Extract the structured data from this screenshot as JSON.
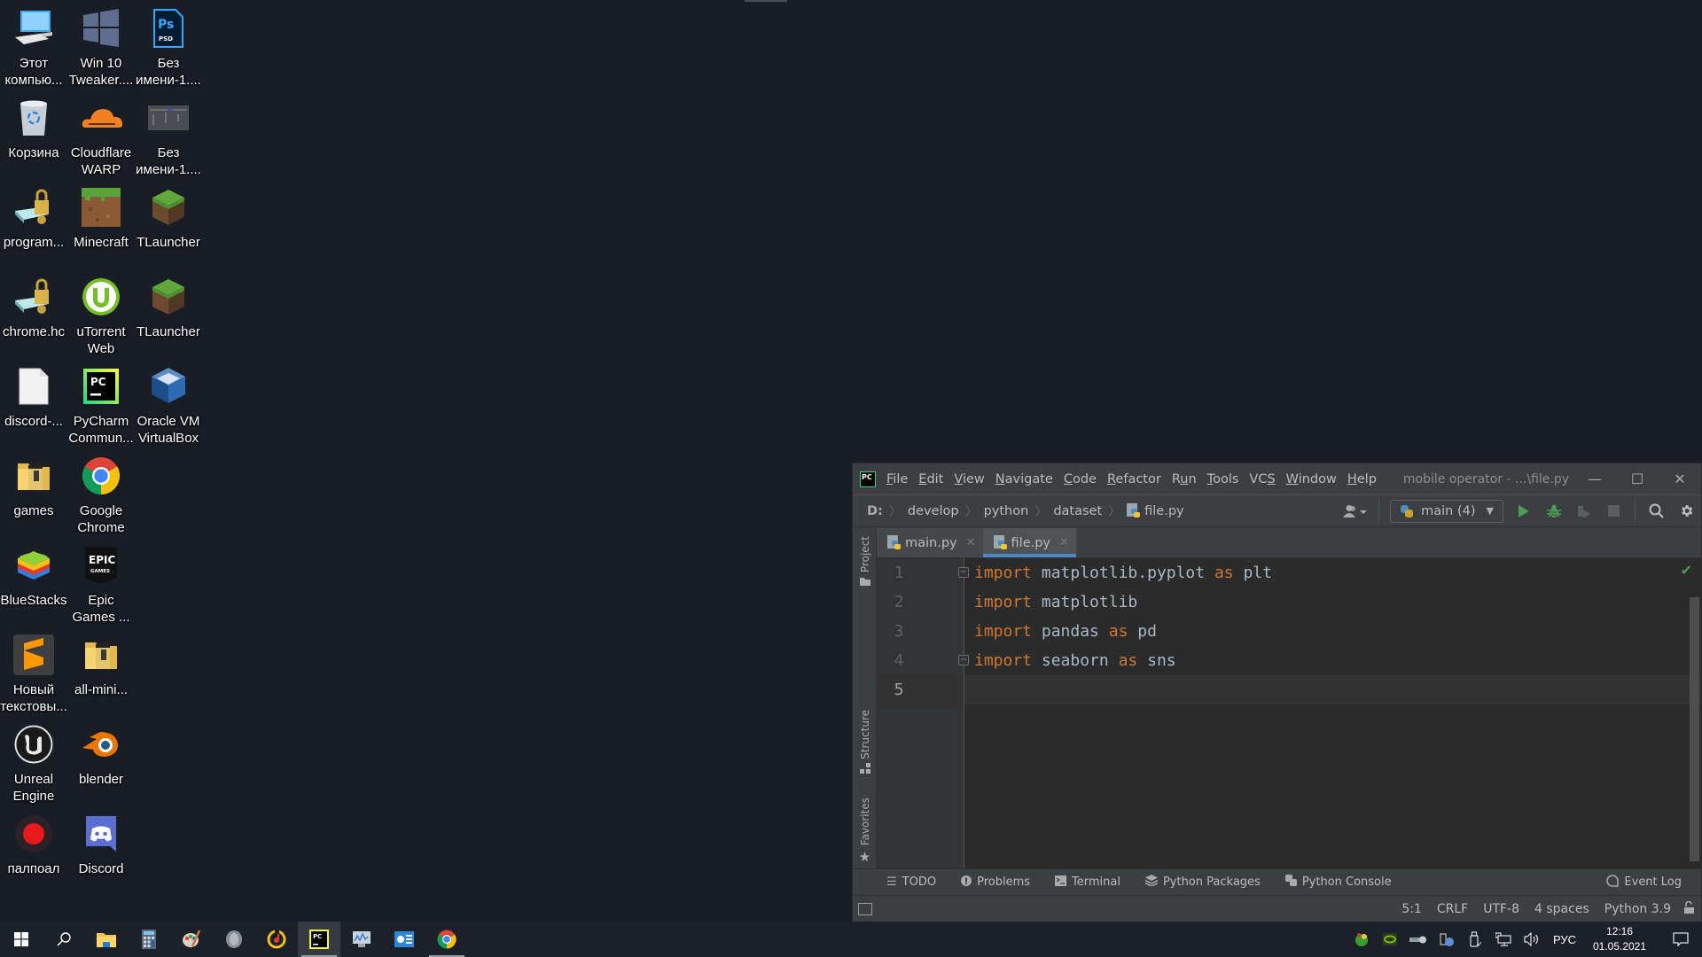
{
  "desktop": {
    "icons": [
      {
        "label": "Этот\nкомпью...",
        "icon": "this-pc-icon"
      },
      {
        "label": "Win 10\nTweaker....",
        "icon": "windows-logo-icon"
      },
      {
        "label": "Без\nимени-1....",
        "icon": "photoshop-psd-icon"
      },
      {
        "label": "Корзина",
        "icon": "recycle-bin-icon"
      },
      {
        "label": "Cloudflare\nWARP",
        "icon": "cloudflare-icon"
      },
      {
        "label": "Без\nимени-1....",
        "icon": "image-thumbnail-icon"
      },
      {
        "label": "program...",
        "icon": "locked-drive-icon"
      },
      {
        "label": "Minecraft",
        "icon": "minecraft-icon"
      },
      {
        "label": "TLauncher",
        "icon": "tlauncher-icon"
      },
      {
        "label": "chrome.hc",
        "icon": "locked-drive-icon"
      },
      {
        "label": "uTorrent\nWeb",
        "icon": "utorrent-icon"
      },
      {
        "label": "TLauncher",
        "icon": "tlauncher-icon"
      },
      {
        "label": "discord-...",
        "icon": "blank-file-icon"
      },
      {
        "label": "PyCharm\nCommun...",
        "icon": "pycharm-icon"
      },
      {
        "label": "Oracle VM\nVirtualBox",
        "icon": "virtualbox-icon"
      },
      {
        "label": "games",
        "icon": "folder-icon"
      },
      {
        "label": "Google\nChrome",
        "icon": "chrome-icon"
      },
      {
        "label": "BlueStacks",
        "icon": "bluestacks-icon"
      },
      {
        "label": "Epic\nGames ...",
        "icon": "epic-games-icon"
      },
      {
        "label": "Новый\nтекстовы...",
        "icon": "sublime-text-icon"
      },
      {
        "label": "all-mini...",
        "icon": "folder-icon"
      },
      {
        "label": "Unreal\nEngine",
        "icon": "unreal-engine-icon"
      },
      {
        "label": "blender",
        "icon": "blender-icon"
      },
      {
        "label": "палпоал",
        "icon": "record-icon"
      },
      {
        "label": "Discord",
        "icon": "discord-icon"
      }
    ]
  },
  "ide": {
    "logo": "PC",
    "menu": [
      {
        "label": "File",
        "mnemonic": "F"
      },
      {
        "label": "Edit",
        "mnemonic": "E"
      },
      {
        "label": "View",
        "mnemonic": "V"
      },
      {
        "label": "Navigate",
        "mnemonic": "N"
      },
      {
        "label": "Code",
        "mnemonic": "C"
      },
      {
        "label": "Refactor",
        "mnemonic": "R"
      },
      {
        "label": "Run",
        "mnemonic": "u"
      },
      {
        "label": "Tools",
        "mnemonic": "T"
      },
      {
        "label": "VCS",
        "mnemonic": "S"
      },
      {
        "label": "Window",
        "mnemonic": "W"
      },
      {
        "label": "Help",
        "mnemonic": "H"
      }
    ],
    "window_title": "mobile operator - ...\\file.py",
    "breadcrumbs": [
      "D:",
      "develop",
      "python",
      "dataset",
      "file.py"
    ],
    "run_config": "main (4)",
    "tabs": [
      {
        "label": "main.py",
        "active": false
      },
      {
        "label": "file.py",
        "active": true
      }
    ],
    "left_tool_windows": [
      "Project",
      "Structure",
      "Favorites"
    ],
    "code_lines": [
      [
        {
          "t": "import",
          "k": true
        },
        {
          "t": " matplotlib.pyplot ",
          "k": false
        },
        {
          "t": "as",
          "k": true
        },
        {
          "t": " plt",
          "k": false
        }
      ],
      [
        {
          "t": "import",
          "k": true
        },
        {
          "t": " matplotlib",
          "k": false
        }
      ],
      [
        {
          "t": "import",
          "k": true
        },
        {
          "t": " pandas ",
          "k": false
        },
        {
          "t": "as",
          "k": true
        },
        {
          "t": " pd",
          "k": false
        }
      ],
      [
        {
          "t": "import",
          "k": true
        },
        {
          "t": " seaborn ",
          "k": false
        },
        {
          "t": "as",
          "k": true
        },
        {
          "t": " sns",
          "k": false
        }
      ],
      []
    ],
    "current_line": 5,
    "tool_tabs": [
      "TODO",
      "Problems",
      "Terminal",
      "Python Packages",
      "Python Console"
    ],
    "event_log": "Event Log",
    "status": {
      "position": "5:1",
      "line_separator": "CRLF",
      "encoding": "UTF-8",
      "indent": "4 spaces",
      "interpreter": "Python 3.9"
    }
  },
  "taskbar": {
    "apps": [
      "start",
      "search",
      "file-explorer",
      "calculator",
      "paint",
      "volume-app",
      "music-player",
      "pycharm",
      "remote-desktop",
      "control-panel",
      "chrome"
    ],
    "language": "РУС",
    "time": "12:16",
    "date": "01.05.2021"
  },
  "colors": {
    "keyword": "#cc7832",
    "identifier": "#a9b7c6",
    "tab_underline": "#4a88c7",
    "run_green": "#499c54"
  }
}
